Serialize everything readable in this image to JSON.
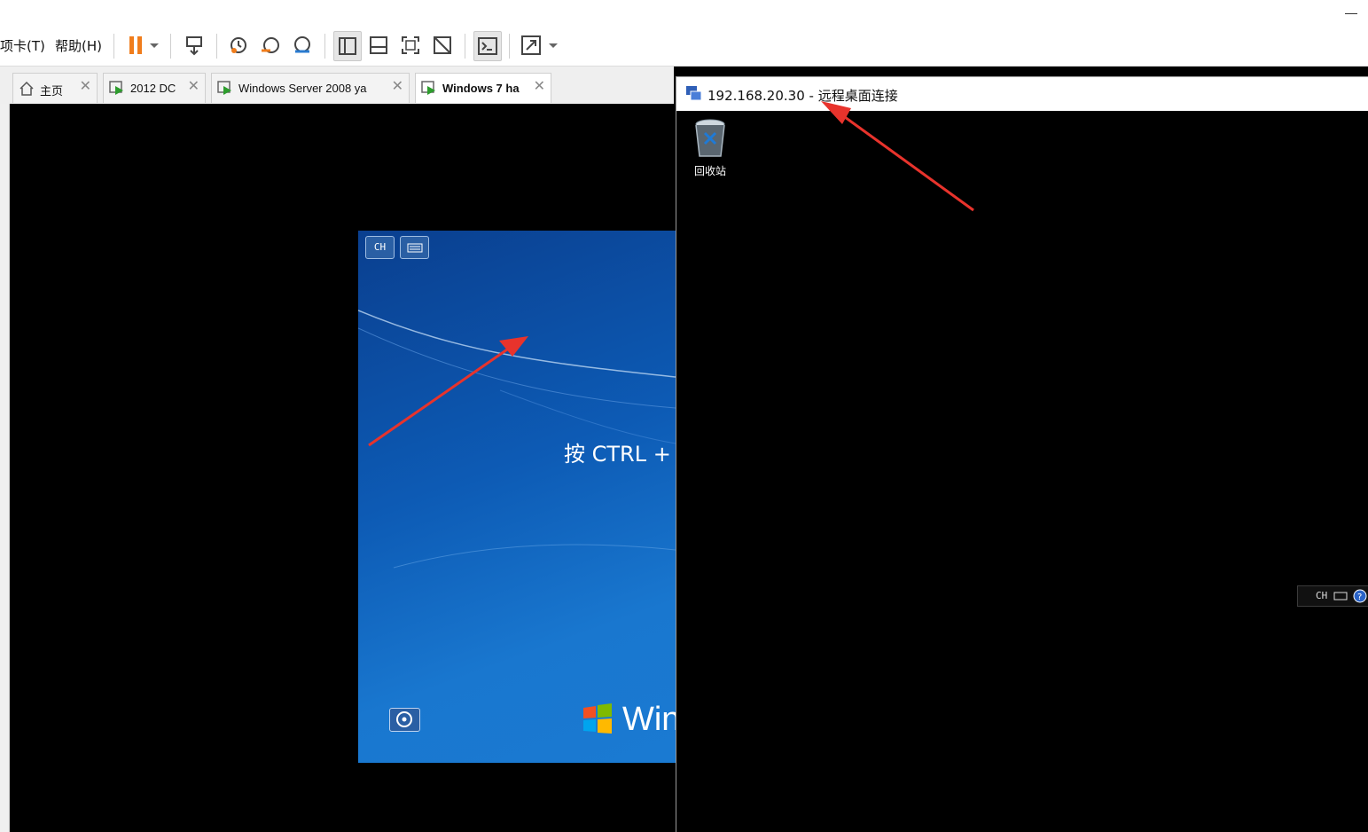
{
  "menu": {
    "items": [
      "项卡(T)",
      "帮助(H)"
    ]
  },
  "toolbar": {
    "buttons": [
      "pause-icon",
      "dropdown-icon",
      "send-keys-icon",
      "snapshot-icon",
      "revert-snapshot-icon",
      "snapshot-manager-icon",
      "library-view-icon",
      "thumbnail-view-icon",
      "fullscreen-icon",
      "unity-icon",
      "console-icon",
      "stretch-icon"
    ]
  },
  "tabs": [
    {
      "label": "主页",
      "icon": "home-icon"
    },
    {
      "label": "2012 DC",
      "icon": "vm-icon"
    },
    {
      "label": "Windows Server 2008 ya",
      "icon": "vm-icon"
    },
    {
      "label": "Windows 7 ha",
      "icon": "vm-icon",
      "active": true
    }
  ],
  "vm": {
    "lang_chip": "CH",
    "login_prompt": "按 CTRL + ",
    "brand_text": "Win"
  },
  "rdp": {
    "title": "192.168.20.30 - 远程桌面连接",
    "desktop_icon_label": "回收站",
    "langbar_label": "CH"
  },
  "colors": {
    "annotation_arrow": "#e8332c",
    "win7_blue": "#0d5bb5",
    "toolbar_pause": "#f07d1c"
  }
}
